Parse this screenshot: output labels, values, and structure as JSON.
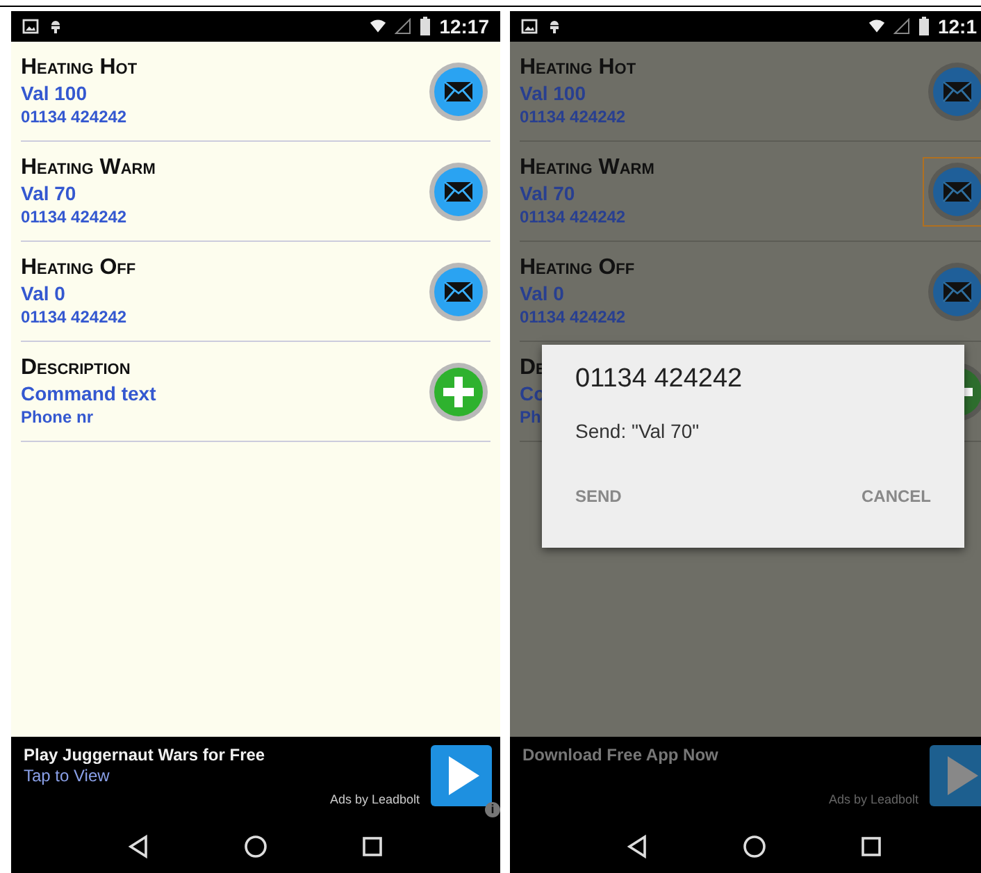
{
  "screens": [
    {
      "status_time": "12:17",
      "dimmed": false,
      "rows": [
        {
          "kind": "message",
          "title": "Heating Hot",
          "value": "Val 100",
          "phone": "01134 424242",
          "selected": false
        },
        {
          "kind": "message",
          "title": "Heating Warm",
          "value": "Val 70",
          "phone": "01134 424242",
          "selected": false
        },
        {
          "kind": "message",
          "title": "Heating Off",
          "value": "Val 0",
          "phone": "01134 424242",
          "selected": false
        },
        {
          "kind": "add",
          "title": "Description",
          "value": "Command text",
          "phone": "Phone nr",
          "selected": false
        }
      ],
      "ad": {
        "headline": "Play Juggernaut Wars for Free",
        "subline": "Tap to View",
        "credit": "Ads by Leadbolt",
        "info_badge": "i"
      }
    },
    {
      "status_time": "12:1",
      "dimmed": true,
      "rows": [
        {
          "kind": "message",
          "title": "Heating Hot",
          "value": "Val 100",
          "phone": "01134 424242",
          "selected": false
        },
        {
          "kind": "message",
          "title": "Heating Warm",
          "value": "Val 70",
          "phone": "01134 424242",
          "selected": true
        },
        {
          "kind": "message",
          "title": "Heating Off",
          "value": "Val 0",
          "phone": "01134 424242",
          "selected": false
        },
        {
          "kind": "add",
          "title": "De",
          "value": "Co",
          "phone": "Ph",
          "selected": false
        }
      ],
      "ad": {
        "headline": "Download Free App Now",
        "credit": "Ads by Leadbolt"
      },
      "dialog": {
        "title": "01134 424242",
        "message": "Send: \"Val 70\"",
        "buttons": [
          "SEND",
          "CANCEL"
        ]
      }
    }
  ]
}
